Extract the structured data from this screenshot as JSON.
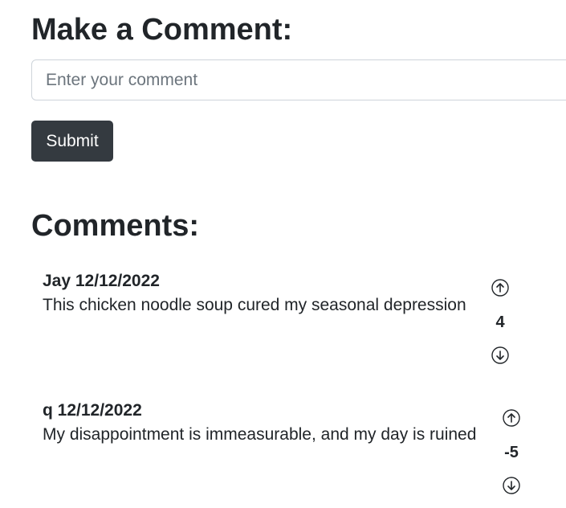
{
  "form": {
    "title": "Make a Comment:",
    "input_placeholder": "Enter your comment",
    "input_value": "",
    "submit_label": "Submit"
  },
  "comments_section": {
    "title": "Comments:",
    "comments": [
      {
        "author": "Jay",
        "date": "12/12/2022",
        "header": "Jay 12/12/2022",
        "text": "This chicken noodle soup cured my seasonal depression",
        "votes": "4"
      },
      {
        "author": "q",
        "date": "12/12/2022",
        "header": "q 12/12/2022",
        "text": "My disappointment is immeasurable, and my day is ruined",
        "votes": "-5"
      }
    ]
  },
  "icons": {
    "upvote": "arrow-up-circle-icon",
    "downvote": "arrow-down-circle-icon"
  }
}
